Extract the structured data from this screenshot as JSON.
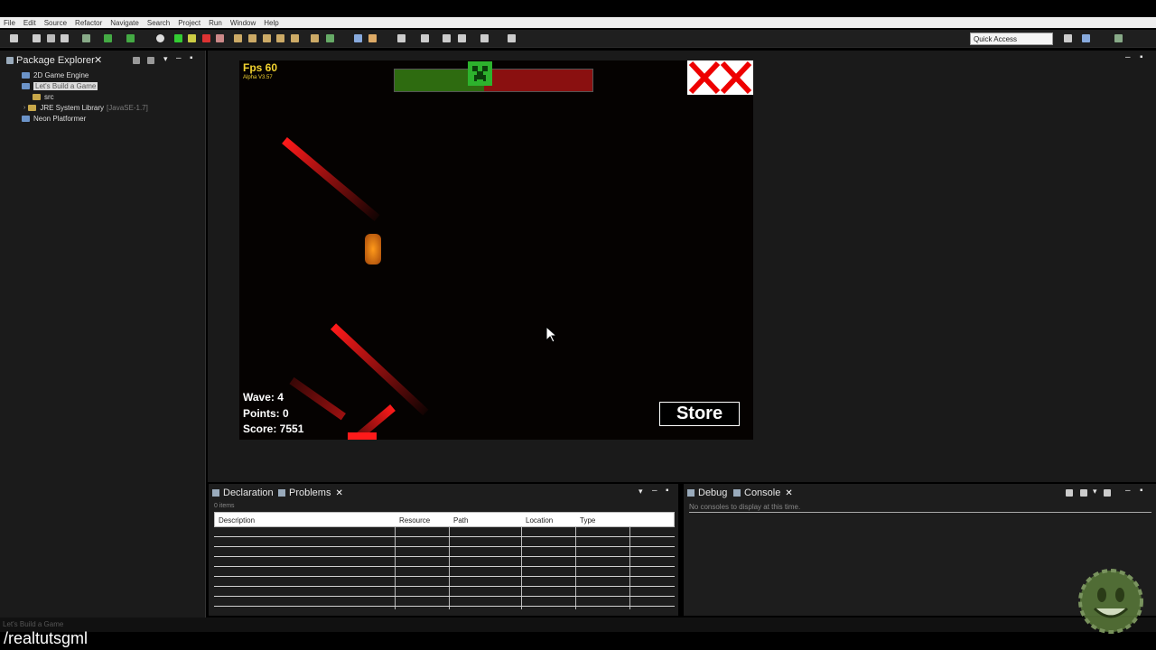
{
  "menu": [
    "File",
    "Edit",
    "Source",
    "Refactor",
    "Navigate",
    "Search",
    "Project",
    "Run",
    "Window",
    "Help"
  ],
  "quick_access": "Quick Access",
  "package_explorer": {
    "tab_label": "Package Explorer",
    "items": [
      {
        "label": "2D Game Engine"
      },
      {
        "label": "Let's Build a Game",
        "selected": true
      },
      {
        "label": "src"
      },
      {
        "label": "JRE System Library",
        "suffix": "[JavaSE-1.7]"
      },
      {
        "label": "Neon Platformer"
      }
    ]
  },
  "game": {
    "fps": "Fps 60",
    "version": "Alpha V3.57",
    "health": 0.45,
    "wave": "Wave: 4",
    "points": "Points: 0",
    "score": "Score: 7551",
    "store": "Store"
  },
  "problems_panel": {
    "tabs": [
      "Declaration",
      "Problems"
    ],
    "items_count": "0 items",
    "columns": [
      "Description",
      "Resource",
      "Path",
      "Location",
      "Type"
    ]
  },
  "console_panel": {
    "tabs": [
      "Debug",
      "Console"
    ],
    "message": "No consoles to display at this time."
  },
  "status_text": "Let's Build a Game",
  "watermark": "/realtutsgml",
  "colors": {
    "health_good": "#2e6b10",
    "health_bad": "#8a1010",
    "fps_text": "#f2d230",
    "trail": "#ff1a1a"
  }
}
